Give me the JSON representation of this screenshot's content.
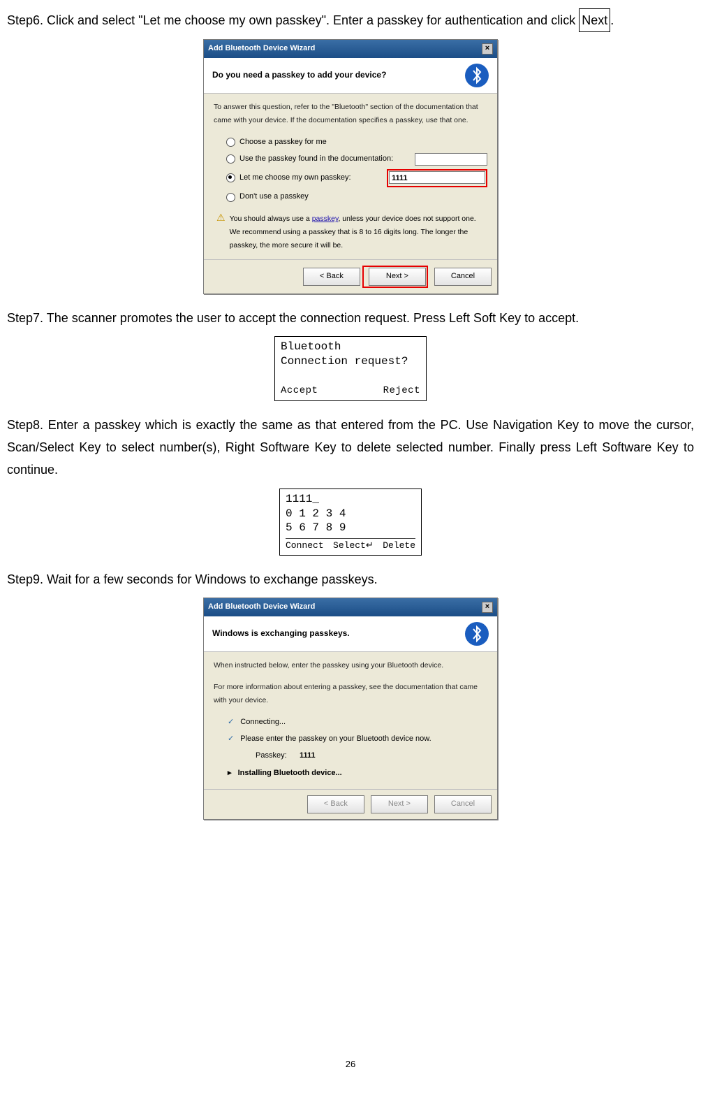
{
  "step6": {
    "text_a": "Step6. Click and select \"Let me choose my own passkey\". Enter a passkey for authentication and click",
    "nextBox": "Next",
    "period": "."
  },
  "wizard1": {
    "title": "Add Bluetooth Device Wizard",
    "heading": "Do you need a passkey to add your device?",
    "note": "To answer this question, refer to the \"Bluetooth\" section of the documentation that came with your device. If the documentation specifies a passkey, use that one.",
    "opt1": "Choose a passkey for me",
    "opt2": "Use the passkey found in the documentation:",
    "opt3": "Let me choose my own passkey:",
    "opt4": "Don't use a passkey",
    "passkeyValue": "1111",
    "tip": "You should always use a passkey, unless your device does not support one. We recommend using a passkey that is 8 to 16 digits long. The longer the passkey, the more secure it will be.",
    "btnBack": "< Back",
    "btnNext": "Next >",
    "btnCancel": "Cancel"
  },
  "step7": "Step7. The scanner promotes the user to accept the connection request. Press Left Soft Key to accept.",
  "lcd1": {
    "l1": "Bluetooth",
    "l2": "Connection request?",
    "left": "Accept",
    "right": "Reject"
  },
  "step8": "Step8. Enter a passkey which is exactly the same as that entered from the PC. Use Navigation Key to move the cursor, Scan/Select Key to select number(s), Right Software Key to delete selected number. Finally press Left Software Key to continue.",
  "lcd2": {
    "l1": "1111_",
    "l2": "0 1 2 3 4",
    "l3": "5 6 7 8 9",
    "b1": "Connect",
    "b2": "Select↵",
    "b3": "Delete"
  },
  "step9": "Step9. Wait for a few seconds for Windows to exchange passkeys.",
  "wizard2": {
    "title": "Add Bluetooth Device Wizard",
    "heading": "Windows is exchanging passkeys.",
    "note1": "When instructed below, enter the passkey using your Bluetooth device.",
    "note2": "For more information about entering a passkey, see the documentation that came with your device.",
    "s1": "Connecting...",
    "s2": "Please enter the passkey on your Bluetooth device now.",
    "pkLabel": "Passkey:",
    "pkValue": "1111",
    "s3": "Installing Bluetooth device...",
    "btnBack": "< Back",
    "btnNext": "Next >",
    "btnCancel": "Cancel"
  },
  "pageNumber": "26"
}
